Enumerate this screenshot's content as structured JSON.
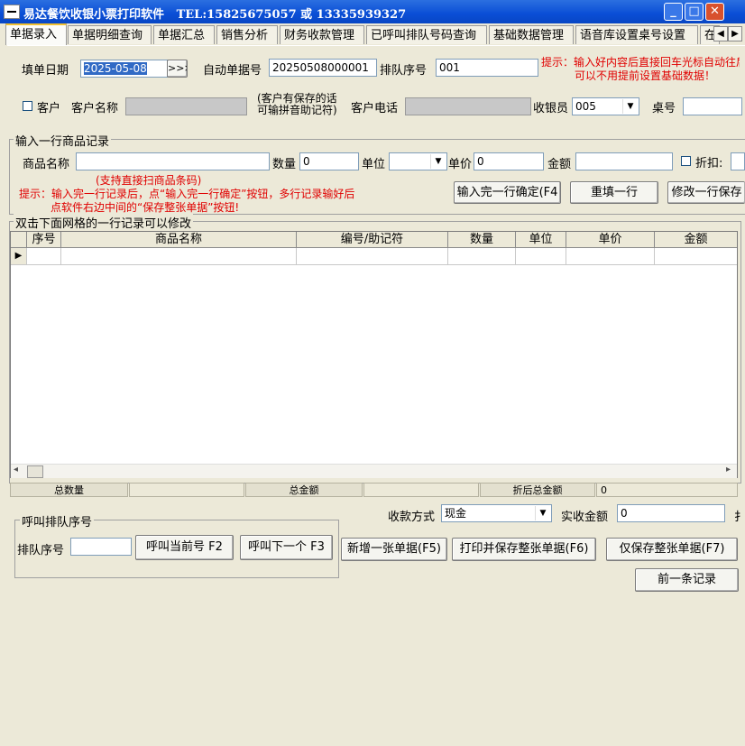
{
  "window": {
    "title": "易达餐饮收银小票打印软件",
    "contact": "TEL:15825675057 或 13335939327",
    "min_symbol": "_",
    "max_symbol": "□",
    "close_symbol": "✕"
  },
  "tabs": [
    "单据录入",
    "单据明细查询",
    "单据汇总",
    "销售分析",
    "财务收款管理",
    "已呼叫排队号码查询",
    "基础数据管理",
    "语音库设置桌号设置",
    "在"
  ],
  "tab_arrows": {
    "left": "◀",
    "right": "▶"
  },
  "header": {
    "date_label": "填单日期",
    "date_value": "2025-05-08",
    "date_button": ">>>",
    "auto_no_label": "自动单据号",
    "auto_no_value": "20250508000001",
    "queue_label": "排队序号",
    "queue_value": "001",
    "tip_line1": "提示：输入好内容后直接回车光标自动往后",
    "tip_line2": "可以不用提前设置基础数据！",
    "customer_check_label": "客户",
    "customer_name_label": "客户名称",
    "customer_note_line1": "(客户有保存的话",
    "customer_note_line2": "可输拼音助记符)",
    "customer_phone_label": "客户电话",
    "cashier_label": "收银员",
    "cashier_value": "005",
    "table_label": "桌号"
  },
  "item_entry": {
    "group_title": "输入一行商品记录",
    "name_label": "商品名称",
    "name_hint": "(支持直接扫商品条码)",
    "qty_label": "数量",
    "qty_value": "0",
    "unit_label": "单位",
    "price_label": "单价",
    "price_value": "0",
    "amount_label": "金额",
    "discount_label": "折扣:",
    "tip_line1": "提示：输入完一行记录后，点“输入完一行确定”按钮，多行记录输好后",
    "tip_line2": "点软件右边中间的“保存整张单据”按钮!",
    "confirm_button": "输入完一行确定(F4",
    "refill_button": "重填一行",
    "modify_button": "修改一行保存"
  },
  "grid": {
    "group_title": "双击下面网格的一行记录可以修改",
    "columns": [
      "序号",
      "商品名称",
      "编号/助记符",
      "数量",
      "单位",
      "单价",
      "金额"
    ],
    "row_indicator": "▶",
    "scroll_left": "◂",
    "scroll_right": "▸"
  },
  "summary": {
    "total_qty_label": "总数量",
    "total_amount_label": "总金额",
    "discounted_total_label": "折后总金额",
    "discounted_total_value": "0"
  },
  "payment": {
    "method_label": "收款方式",
    "method_value": "现金",
    "received_label": "实收金额",
    "received_value": "0",
    "cut_char": "扌"
  },
  "call_queue": {
    "group_title": "呼叫排队序号",
    "queue_label": "排队序号",
    "call_current_button": "呼叫当前号 F2",
    "call_next_button": "呼叫下一个 F3"
  },
  "actions": {
    "new_button": "新增一张单据(F5)",
    "print_save_button": "打印并保存整张单据(F6)",
    "save_only_button": "仅保存整张单据(F7)",
    "prev_button": "前一条记录"
  },
  "colors": {
    "title_bar": "#0a4ed6",
    "tip_red": "#e00000",
    "window_bg": "#ece9d8",
    "date_highlight": "#316ac5"
  }
}
